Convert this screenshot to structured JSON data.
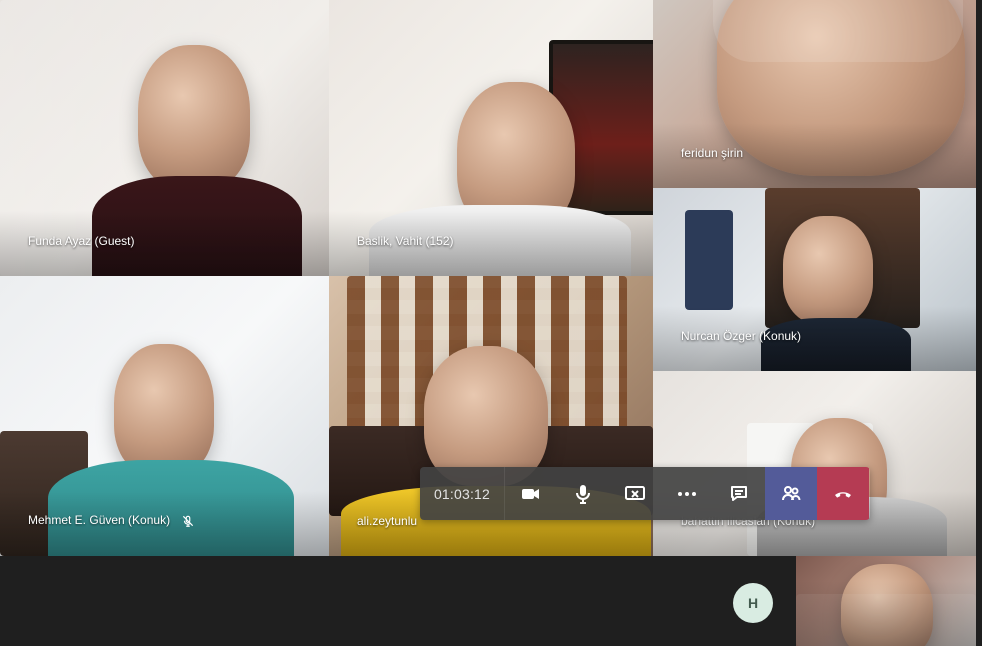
{
  "participants": {
    "funda": "Funda Ayaz (Guest)",
    "baslik": "Baslik, Vahit (152)",
    "feridun": "feridun şirin",
    "nurcan": "Nurcan Özger (Konuk)",
    "mehmet": "Mehmet E. Güven (Konuk)",
    "ali": "ali.zeytunlu",
    "bahattin": "bahattin ilicaslan (Konuk)"
  },
  "controls": {
    "timer": "01:03:12"
  },
  "self": {
    "avatar_initial": "H"
  },
  "colors": {
    "meeting_bar": "#1f1f1f",
    "participants_active": "#535b99",
    "hang_up": "#b53b53"
  }
}
